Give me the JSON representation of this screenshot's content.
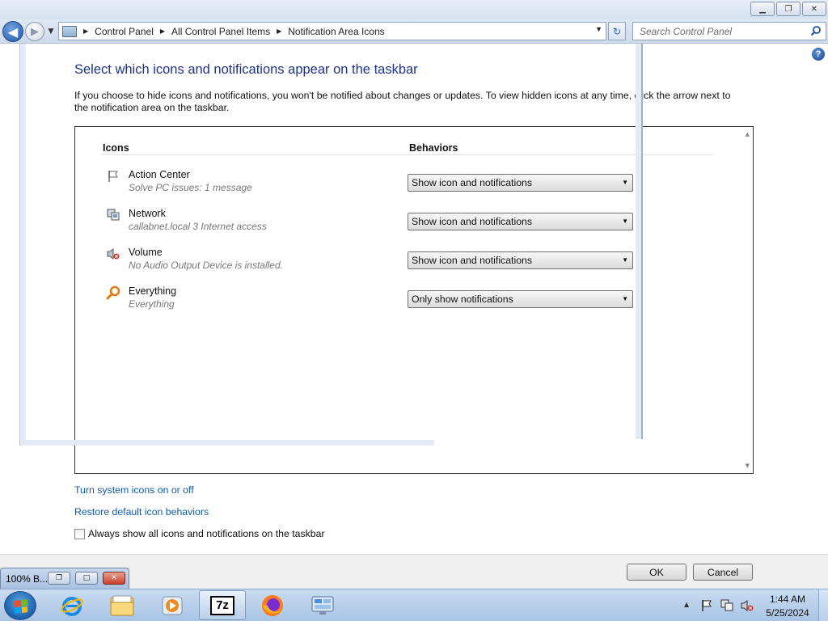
{
  "window": {
    "minimize_glyph": "▁",
    "maximize_glyph": "❐",
    "close_glyph": "✕"
  },
  "address_bar": {
    "crumbs": [
      "Control Panel",
      "All Control Panel Items",
      "Notification Area Icons"
    ],
    "search_placeholder": "Search Control Panel"
  },
  "page": {
    "title": "Select which icons and notifications appear on the taskbar",
    "description": "If you choose to hide icons and notifications, you won't be notified about changes or updates. To view hidden icons at any time, click the arrow next to the notification area on the taskbar.",
    "columns": {
      "icons": "Icons",
      "behaviors": "Behaviors"
    },
    "rows": [
      {
        "name": "Action Center",
        "sub": "Solve PC issues: 1 message",
        "behavior": "Show icon and notifications",
        "icon": "flag-icon"
      },
      {
        "name": "Network",
        "sub": "callabnet.local  3 Internet access",
        "behavior": "Show icon and notifications",
        "icon": "network-icon"
      },
      {
        "name": "Volume",
        "sub": "No Audio Output Device is installed.",
        "behavior": "Show icon and notifications",
        "icon": "volume-muted-icon"
      },
      {
        "name": "Everything",
        "sub": "Everything",
        "behavior": "Only show notifications",
        "icon": "magnifier-icon"
      }
    ],
    "links": {
      "system_icons": "Turn system icons on or off",
      "restore_defaults": "Restore default icon behaviors"
    },
    "always_show_label": "Always show all icons and notifications on the taskbar",
    "always_show_checked": false
  },
  "footer": {
    "ok": "OK",
    "cancel": "Cancel"
  },
  "minimized_window": {
    "title": "100% B..."
  },
  "taskbar": {
    "apps": [
      "internet-explorer-icon",
      "file-explorer-icon",
      "media-player-icon",
      "7zip-icon",
      "firefox-icon",
      "control-panel-icon"
    ],
    "active_app": "7zip-icon",
    "app_7zip_label": "7z",
    "clock_time": "1:44 AM",
    "clock_date": "5/25/2024"
  },
  "colors": {
    "title": "#1e3287",
    "link": "#0b5cad",
    "taskbar": "#b6cde8"
  }
}
